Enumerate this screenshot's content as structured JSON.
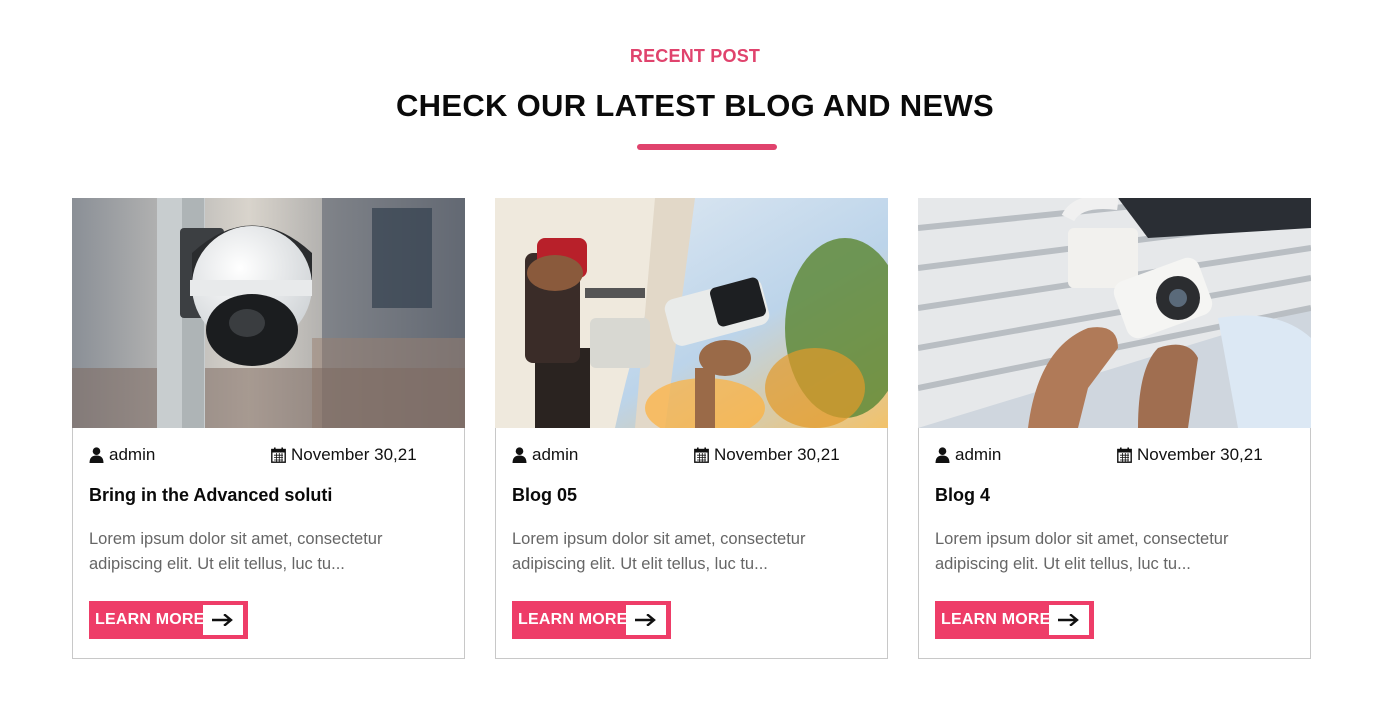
{
  "section": {
    "eyebrow": "RECENT POST",
    "headline": "CHECK OUR LATEST BLOG AND NEWS",
    "accent_color": "#e0436d"
  },
  "posts": [
    {
      "image": "dome-cctv-camera-on-pole",
      "author_icon": "user-icon",
      "author": "admin",
      "date_icon": "calendar-icon",
      "date": "November 30,21",
      "title": "Bring in the Advanced soluti",
      "excerpt": "Lorem ipsum dolor sit amet, consectetur adipiscing elit. Ut elit tellus, luc tu...",
      "button_label": "LEARN MORE",
      "button_icon": "arrow-right-icon"
    },
    {
      "image": "installing-bullet-camera-with-drill",
      "author_icon": "user-icon",
      "author": "admin",
      "date_icon": "calendar-icon",
      "date": "November 30,21",
      "title": "Blog 05",
      "excerpt": "Lorem ipsum dolor sit amet, consectetur adipiscing elit. Ut elit tellus, luc tu...",
      "button_label": "LEARN MORE",
      "button_icon": "arrow-right-icon"
    },
    {
      "image": "hands-mounting-camera-under-roof",
      "author_icon": "user-icon",
      "author": "admin",
      "date_icon": "calendar-icon",
      "date": "November 30,21",
      "title": "Blog 4",
      "excerpt": "Lorem ipsum dolor sit amet, consectetur adipiscing elit. Ut elit tellus, luc tu...",
      "button_label": "LEARN MORE",
      "button_icon": "arrow-right-icon"
    }
  ]
}
